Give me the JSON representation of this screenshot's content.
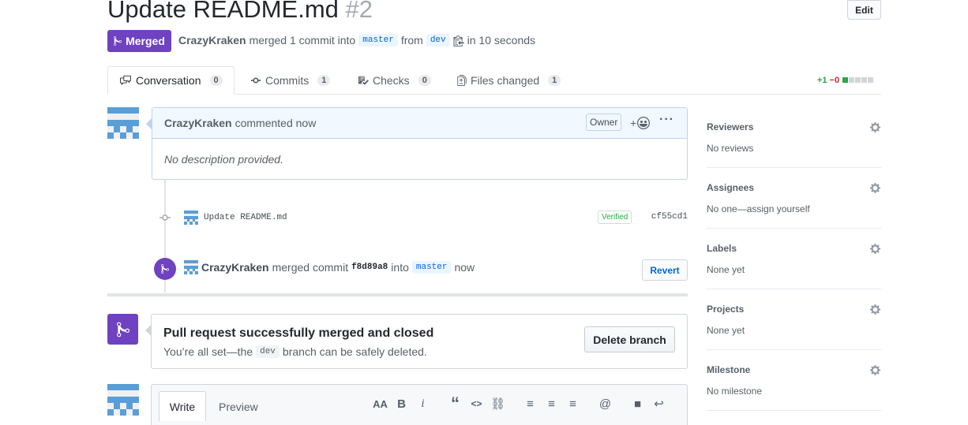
{
  "header": {
    "title": "Update README.md",
    "number": "#2",
    "edit_label": "Edit"
  },
  "state": {
    "label": "Merged",
    "author": "CrazyKraken",
    "action": "merged 1 commit into",
    "base_branch": "master",
    "from_word": "from",
    "head_branch": "dev",
    "time": "in 10 seconds"
  },
  "tabs": [
    {
      "label": "Conversation",
      "count": "0",
      "icon": "comment-icon"
    },
    {
      "label": "Commits",
      "count": "1",
      "icon": "commit-icon"
    },
    {
      "label": "Checks",
      "count": "0",
      "icon": "checklist-icon"
    },
    {
      "label": "Files changed",
      "count": "1",
      "icon": "file-diff-icon"
    }
  ],
  "diffstat": {
    "additions": "+1",
    "deletions": "−0",
    "green_blocks": 1,
    "gray_blocks": 4
  },
  "comment": {
    "author": "CrazyKraken",
    "action": "commented now",
    "owner_label": "Owner",
    "reaction": "+",
    "body": "No description provided."
  },
  "commit": {
    "message": "Update README.md",
    "verified": "Verified",
    "sha": "cf55cd1"
  },
  "merge_event": {
    "author": "CrazyKraken",
    "action": "merged commit",
    "sha": "f8d89a8",
    "into": "into",
    "branch": "master",
    "time": "now",
    "revert_label": "Revert"
  },
  "mergebox": {
    "title": "Pull request successfully merged and closed",
    "sub_before": "You’re all set—the",
    "branch": "dev",
    "sub_after": "branch can be safely deleted.",
    "delete_label": "Delete branch"
  },
  "editor": {
    "write_label": "Write",
    "preview_label": "Preview",
    "toolbar": [
      {
        "name": "header-text-icon",
        "glyph": "AA"
      },
      {
        "name": "bold-icon",
        "glyph": "B"
      },
      {
        "name": "italic-icon",
        "glyph": "i"
      },
      {
        "name": "quote-icon",
        "glyph": "“"
      },
      {
        "name": "code-icon",
        "glyph": "<>"
      },
      {
        "name": "link-icon",
        "glyph": "⛓"
      },
      {
        "name": "unordered-list-icon",
        "glyph": "≡"
      },
      {
        "name": "ordered-list-icon",
        "glyph": "≡"
      },
      {
        "name": "task-list-icon",
        "glyph": "≡"
      },
      {
        "name": "mention-icon",
        "glyph": "@"
      },
      {
        "name": "bookmark-icon",
        "glyph": "■"
      },
      {
        "name": "reply-icon",
        "glyph": "↩"
      }
    ]
  },
  "sidebar": [
    {
      "heading": "Reviewers",
      "value": "No reviews"
    },
    {
      "heading": "Assignees",
      "value": "No one—assign yourself"
    },
    {
      "heading": "Labels",
      "value": "None yet"
    },
    {
      "heading": "Projects",
      "value": "None yet"
    },
    {
      "heading": "Milestone",
      "value": "No milestone"
    }
  ],
  "colors": {
    "merged_purple": "#6f42c1",
    "link_blue": "#0366d6",
    "add_green": "#28a745",
    "del_red": "#cb2431"
  }
}
